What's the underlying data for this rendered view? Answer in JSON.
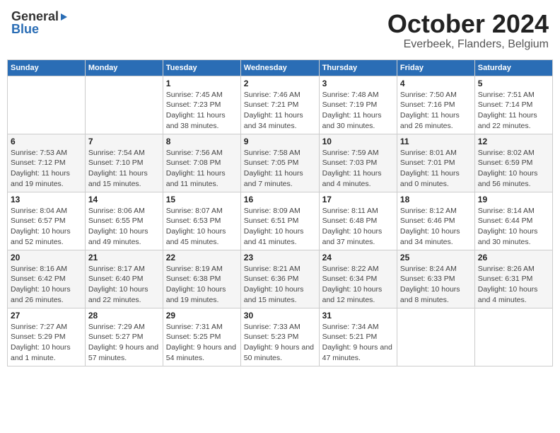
{
  "header": {
    "logo_general": "General",
    "logo_blue": "Blue",
    "month": "October 2024",
    "location": "Everbeek, Flanders, Belgium"
  },
  "columns": [
    "Sunday",
    "Monday",
    "Tuesday",
    "Wednesday",
    "Thursday",
    "Friday",
    "Saturday"
  ],
  "weeks": [
    [
      {
        "day": "",
        "sunrise": "",
        "sunset": "",
        "daylight": ""
      },
      {
        "day": "",
        "sunrise": "",
        "sunset": "",
        "daylight": ""
      },
      {
        "day": "1",
        "sunrise": "Sunrise: 7:45 AM",
        "sunset": "Sunset: 7:23 PM",
        "daylight": "Daylight: 11 hours and 38 minutes."
      },
      {
        "day": "2",
        "sunrise": "Sunrise: 7:46 AM",
        "sunset": "Sunset: 7:21 PM",
        "daylight": "Daylight: 11 hours and 34 minutes."
      },
      {
        "day": "3",
        "sunrise": "Sunrise: 7:48 AM",
        "sunset": "Sunset: 7:19 PM",
        "daylight": "Daylight: 11 hours and 30 minutes."
      },
      {
        "day": "4",
        "sunrise": "Sunrise: 7:50 AM",
        "sunset": "Sunset: 7:16 PM",
        "daylight": "Daylight: 11 hours and 26 minutes."
      },
      {
        "day": "5",
        "sunrise": "Sunrise: 7:51 AM",
        "sunset": "Sunset: 7:14 PM",
        "daylight": "Daylight: 11 hours and 22 minutes."
      }
    ],
    [
      {
        "day": "6",
        "sunrise": "Sunrise: 7:53 AM",
        "sunset": "Sunset: 7:12 PM",
        "daylight": "Daylight: 11 hours and 19 minutes."
      },
      {
        "day": "7",
        "sunrise": "Sunrise: 7:54 AM",
        "sunset": "Sunset: 7:10 PM",
        "daylight": "Daylight: 11 hours and 15 minutes."
      },
      {
        "day": "8",
        "sunrise": "Sunrise: 7:56 AM",
        "sunset": "Sunset: 7:08 PM",
        "daylight": "Daylight: 11 hours and 11 minutes."
      },
      {
        "day": "9",
        "sunrise": "Sunrise: 7:58 AM",
        "sunset": "Sunset: 7:05 PM",
        "daylight": "Daylight: 11 hours and 7 minutes."
      },
      {
        "day": "10",
        "sunrise": "Sunrise: 7:59 AM",
        "sunset": "Sunset: 7:03 PM",
        "daylight": "Daylight: 11 hours and 4 minutes."
      },
      {
        "day": "11",
        "sunrise": "Sunrise: 8:01 AM",
        "sunset": "Sunset: 7:01 PM",
        "daylight": "Daylight: 11 hours and 0 minutes."
      },
      {
        "day": "12",
        "sunrise": "Sunrise: 8:02 AM",
        "sunset": "Sunset: 6:59 PM",
        "daylight": "Daylight: 10 hours and 56 minutes."
      }
    ],
    [
      {
        "day": "13",
        "sunrise": "Sunrise: 8:04 AM",
        "sunset": "Sunset: 6:57 PM",
        "daylight": "Daylight: 10 hours and 52 minutes."
      },
      {
        "day": "14",
        "sunrise": "Sunrise: 8:06 AM",
        "sunset": "Sunset: 6:55 PM",
        "daylight": "Daylight: 10 hours and 49 minutes."
      },
      {
        "day": "15",
        "sunrise": "Sunrise: 8:07 AM",
        "sunset": "Sunset: 6:53 PM",
        "daylight": "Daylight: 10 hours and 45 minutes."
      },
      {
        "day": "16",
        "sunrise": "Sunrise: 8:09 AM",
        "sunset": "Sunset: 6:51 PM",
        "daylight": "Daylight: 10 hours and 41 minutes."
      },
      {
        "day": "17",
        "sunrise": "Sunrise: 8:11 AM",
        "sunset": "Sunset: 6:48 PM",
        "daylight": "Daylight: 10 hours and 37 minutes."
      },
      {
        "day": "18",
        "sunrise": "Sunrise: 8:12 AM",
        "sunset": "Sunset: 6:46 PM",
        "daylight": "Daylight: 10 hours and 34 minutes."
      },
      {
        "day": "19",
        "sunrise": "Sunrise: 8:14 AM",
        "sunset": "Sunset: 6:44 PM",
        "daylight": "Daylight: 10 hours and 30 minutes."
      }
    ],
    [
      {
        "day": "20",
        "sunrise": "Sunrise: 8:16 AM",
        "sunset": "Sunset: 6:42 PM",
        "daylight": "Daylight: 10 hours and 26 minutes."
      },
      {
        "day": "21",
        "sunrise": "Sunrise: 8:17 AM",
        "sunset": "Sunset: 6:40 PM",
        "daylight": "Daylight: 10 hours and 22 minutes."
      },
      {
        "day": "22",
        "sunrise": "Sunrise: 8:19 AM",
        "sunset": "Sunset: 6:38 PM",
        "daylight": "Daylight: 10 hours and 19 minutes."
      },
      {
        "day": "23",
        "sunrise": "Sunrise: 8:21 AM",
        "sunset": "Sunset: 6:36 PM",
        "daylight": "Daylight: 10 hours and 15 minutes."
      },
      {
        "day": "24",
        "sunrise": "Sunrise: 8:22 AM",
        "sunset": "Sunset: 6:34 PM",
        "daylight": "Daylight: 10 hours and 12 minutes."
      },
      {
        "day": "25",
        "sunrise": "Sunrise: 8:24 AM",
        "sunset": "Sunset: 6:33 PM",
        "daylight": "Daylight: 10 hours and 8 minutes."
      },
      {
        "day": "26",
        "sunrise": "Sunrise: 8:26 AM",
        "sunset": "Sunset: 6:31 PM",
        "daylight": "Daylight: 10 hours and 4 minutes."
      }
    ],
    [
      {
        "day": "27",
        "sunrise": "Sunrise: 7:27 AM",
        "sunset": "Sunset: 5:29 PM",
        "daylight": "Daylight: 10 hours and 1 minute."
      },
      {
        "day": "28",
        "sunrise": "Sunrise: 7:29 AM",
        "sunset": "Sunset: 5:27 PM",
        "daylight": "Daylight: 9 hours and 57 minutes."
      },
      {
        "day": "29",
        "sunrise": "Sunrise: 7:31 AM",
        "sunset": "Sunset: 5:25 PM",
        "daylight": "Daylight: 9 hours and 54 minutes."
      },
      {
        "day": "30",
        "sunrise": "Sunrise: 7:33 AM",
        "sunset": "Sunset: 5:23 PM",
        "daylight": "Daylight: 9 hours and 50 minutes."
      },
      {
        "day": "31",
        "sunrise": "Sunrise: 7:34 AM",
        "sunset": "Sunset: 5:21 PM",
        "daylight": "Daylight: 9 hours and 47 minutes."
      },
      {
        "day": "",
        "sunrise": "",
        "sunset": "",
        "daylight": ""
      },
      {
        "day": "",
        "sunrise": "",
        "sunset": "",
        "daylight": ""
      }
    ]
  ]
}
